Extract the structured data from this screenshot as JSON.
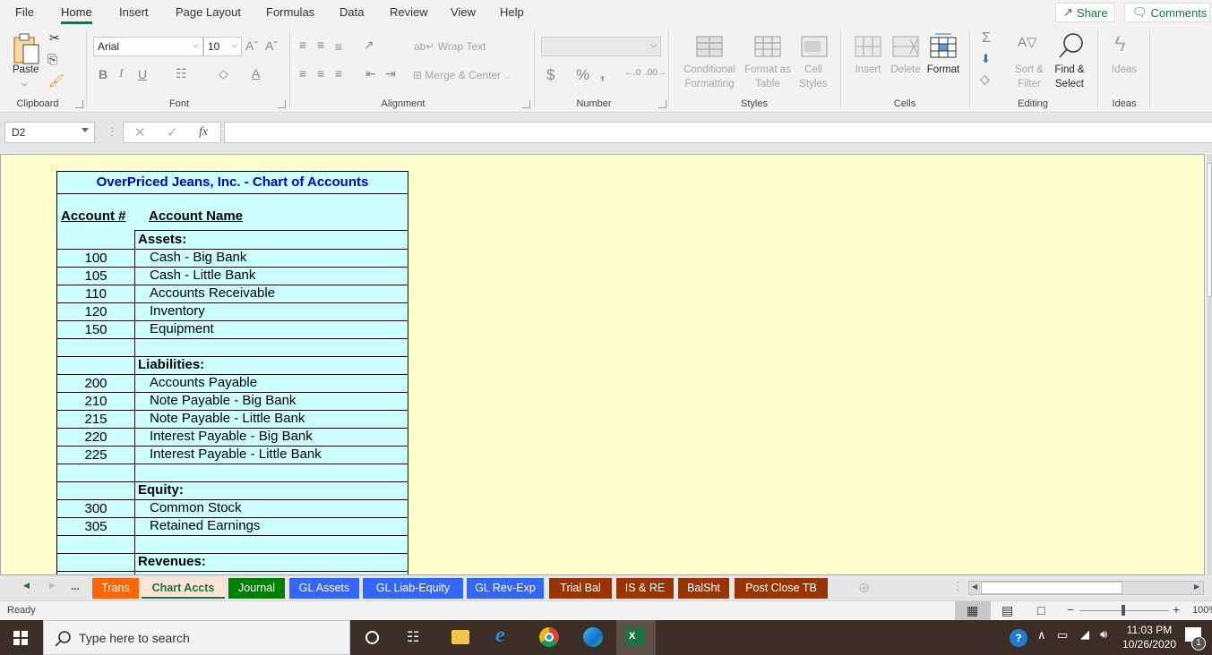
{
  "menu": {
    "tabs": [
      "File",
      "Home",
      "Insert",
      "Page Layout",
      "Formulas",
      "Data",
      "Review",
      "View",
      "Help"
    ],
    "active_tab": "Home",
    "share_label": "Share",
    "comments_label": "Comments"
  },
  "ribbon": {
    "clipboard": {
      "paste_label": "Paste",
      "group_label": "Clipboard"
    },
    "font": {
      "font_name": "Arial",
      "font_size": "10",
      "group_label": "Font"
    },
    "alignment": {
      "wrap_text": "Wrap Text",
      "merge_center": "Merge & Center",
      "group_label": "Alignment"
    },
    "number": {
      "format_value": "",
      "group_label": "Number"
    },
    "styles": {
      "conditional_formatting_1": "Conditional",
      "conditional_formatting_2": "Formatting",
      "format_as_table_1": "Format as",
      "format_as_table_2": "Table",
      "cell_styles_1": "Cell",
      "cell_styles_2": "Styles",
      "group_label": "Styles"
    },
    "cells": {
      "insert": "Insert",
      "delete": "Delete",
      "format": "Format",
      "group_label": "Cells"
    },
    "editing": {
      "sort_filter_1": "Sort &",
      "sort_filter_2": "Filter",
      "find_select_1": "Find &",
      "find_select_2": "Select",
      "group_label": "Editing"
    },
    "ideas": {
      "label": "Ideas",
      "group_label": "Ideas"
    }
  },
  "formula_bar": {
    "name_box": "D2",
    "formula": ""
  },
  "sheet": {
    "title": "OverPriced Jeans, Inc. - Chart of Accounts",
    "col_account_num": "Account #",
    "col_account_name": "Account Name",
    "rows": [
      {
        "num": "",
        "name": "Assets:",
        "section": true
      },
      {
        "num": "100",
        "name": "Cash - Big Bank"
      },
      {
        "num": "105",
        "name": "Cash - Little Bank"
      },
      {
        "num": "110",
        "name": "Accounts Receivable"
      },
      {
        "num": "120",
        "name": "Inventory"
      },
      {
        "num": "150",
        "name": "Equipment"
      },
      {
        "num": "",
        "name": ""
      },
      {
        "num": "",
        "name": "Liabilities:",
        "section": true
      },
      {
        "num": "200",
        "name": "Accounts Payable"
      },
      {
        "num": "210",
        "name": "Note Payable - Big Bank"
      },
      {
        "num": "215",
        "name": "Note Payable - Little Bank"
      },
      {
        "num": "220",
        "name": "Interest Payable - Big Bank"
      },
      {
        "num": "225",
        "name": "Interest Payable - Little Bank"
      },
      {
        "num": "",
        "name": ""
      },
      {
        "num": "",
        "name": "Equity:",
        "section": true
      },
      {
        "num": "300",
        "name": "Common Stock"
      },
      {
        "num": "305",
        "name": "Retained Earnings"
      },
      {
        "num": "",
        "name": ""
      },
      {
        "num": "",
        "name": "Revenues:",
        "section": true
      },
      {
        "num": "",
        "name": ""
      }
    ]
  },
  "sheet_tabs": [
    {
      "label": "Trans",
      "color": "#ff6600"
    },
    {
      "label": "Chart Accts",
      "color": "#fde4d6",
      "active": true
    },
    {
      "label": "Journal",
      "color": "#008000"
    },
    {
      "label": "GL Assets",
      "color": "#3366ff"
    },
    {
      "label": "GL Liab-Equity",
      "color": "#3366ff"
    },
    {
      "label": "GL Rev-Exp",
      "color": "#3366ff"
    },
    {
      "label": "Trial Bal",
      "color": "#993300"
    },
    {
      "label": "IS & RE",
      "color": "#993300"
    },
    {
      "label": "BalSht",
      "color": "#993300"
    },
    {
      "label": "Post Close TB",
      "color": "#993300"
    }
  ],
  "tab_nav": {
    "more": "..."
  },
  "status": {
    "ready": "Ready",
    "zoom": "100%"
  },
  "taskbar": {
    "search_placeholder": "Type here to search",
    "time": "11:03 PM",
    "date": "10/26/2020",
    "notification_count": "1"
  }
}
